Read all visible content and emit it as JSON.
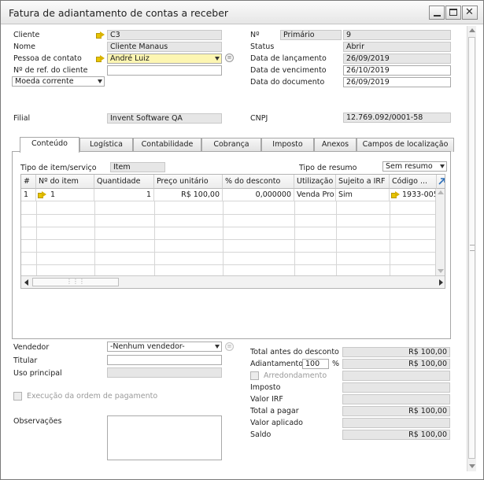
{
  "window": {
    "title": "Fatura de adiantamento de contas a receber"
  },
  "header": {
    "cliente_label": "Cliente",
    "cliente_value": "C3",
    "nome_label": "Nome",
    "nome_value": "Cliente Manaus",
    "pessoa_label": "Pessoa de contato",
    "pessoa_value": "André Luiz",
    "ref_label": "Nº de ref. do cliente",
    "ref_value": "",
    "moeda_value": "Moeda corrente",
    "filial_label": "Filial",
    "filial_value": "Invent Software QA",
    "no_label": "Nº",
    "series_value": "Primário",
    "doc_no_value": "9",
    "status_label": "Status",
    "status_value": "Abrir",
    "lanc_label": "Data de lançamento",
    "lanc_value": "26/09/2019",
    "venc_label": "Data de vencimento",
    "venc_value": "26/10/2019",
    "docdate_label": "Data do documento",
    "docdate_value": "26/09/2019",
    "cnpj_label": "CNPJ",
    "cnpj_value": "12.769.092/0001-58"
  },
  "tabs": [
    "Conteúdo",
    "Logística",
    "Contabilidade",
    "Cobrança",
    "Imposto",
    "Anexos",
    "Campos de localização"
  ],
  "content": {
    "tipo_item_label": "Tipo de item/serviço",
    "tipo_item_value": "Item",
    "tipo_resumo_label": "Tipo de resumo",
    "tipo_resumo_value": "Sem resumo",
    "columns": [
      "#",
      "Nº do item",
      "Quantidade",
      "Preço unitário",
      "% do desconto",
      "Utilização",
      "Sujeito a IRF",
      "Código ..."
    ],
    "rows": [
      [
        "1",
        "1",
        "1",
        "R$ 100,00",
        "0,000000",
        "Venda Pro",
        "Sim",
        "1933-005"
      ]
    ]
  },
  "footer": {
    "vendedor_label": "Vendedor",
    "vendedor_value": "-Nenhum vendedor-",
    "titular_label": "Titular",
    "titular_value": "",
    "uso_label": "Uso principal",
    "uso_value": "",
    "execucao_label": "Execução da ordem de pagamento",
    "obs_label": "Observações",
    "total_antes_label": "Total antes do desconto",
    "total_antes_value": "R$ 100,00",
    "adiant_label": "Adiantamento",
    "adiant_pct": "100",
    "pct_sign": "%",
    "adiant_value": "R$ 100,00",
    "arred_label": "Arredondamento",
    "arred_value": "",
    "imposto_label": "Imposto",
    "imposto_value": "",
    "irf_label": "Valor IRF",
    "irf_value": "",
    "total_pagar_label": "Total a pagar",
    "total_pagar_value": "R$ 100,00",
    "valor_aplicado_label": "Valor aplicado",
    "valor_aplicado_value": "",
    "saldo_label": "Saldo",
    "saldo_value": "R$ 100,00"
  }
}
